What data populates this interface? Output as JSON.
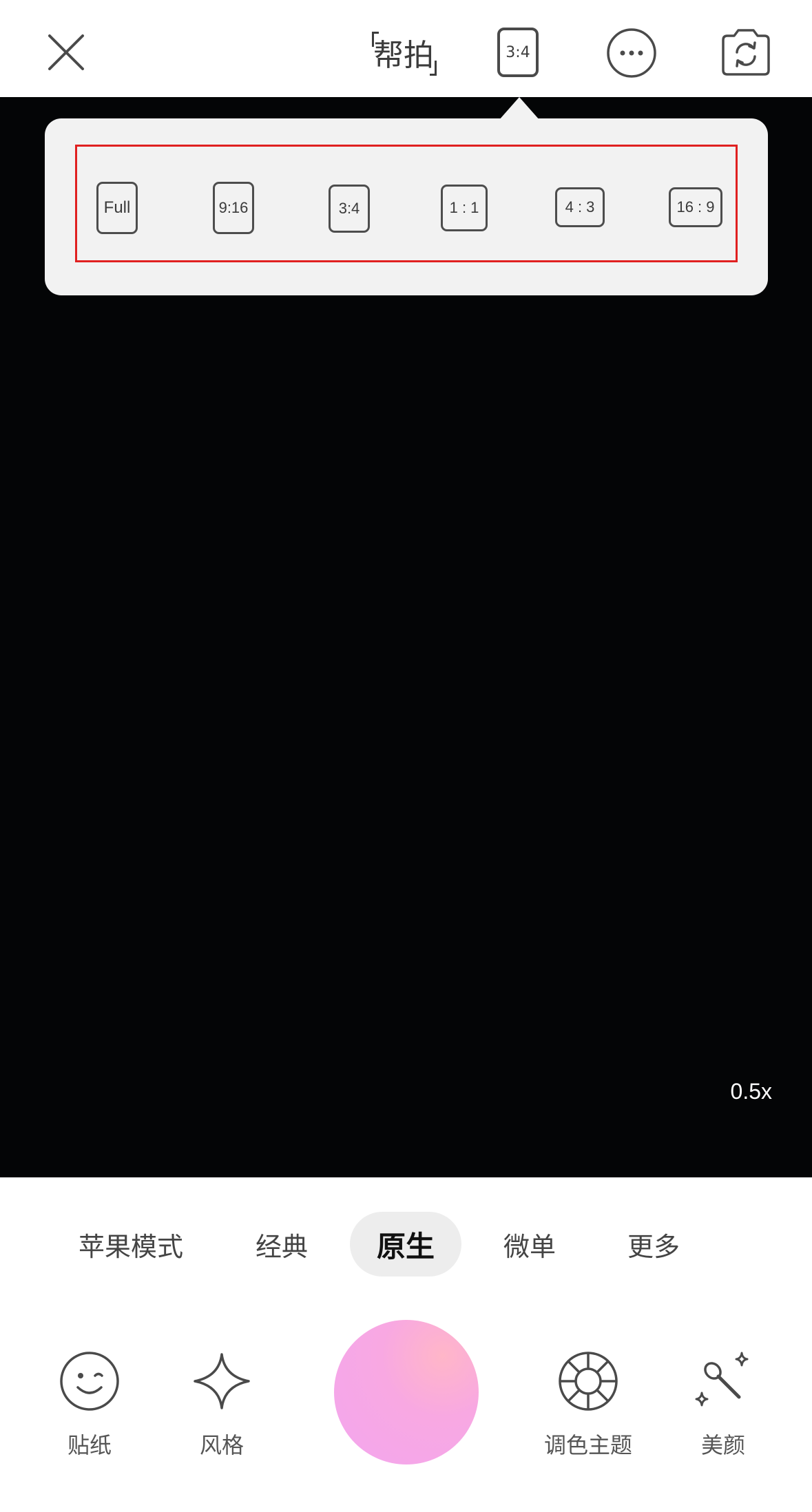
{
  "topbar": {
    "help_shoot_label": "帮拍",
    "current_ratio": "3:4"
  },
  "ratio_popup": {
    "options": [
      "Full",
      "9:16",
      "3:4",
      "1 : 1",
      "4 : 3",
      "16 : 9"
    ]
  },
  "viewfinder": {
    "zoom": "0.5x"
  },
  "modes": {
    "items": [
      "苹果模式",
      "经典",
      "原生",
      "微单",
      "更多"
    ],
    "selected": "原生"
  },
  "tools": {
    "sticker": "贴纸",
    "style": "风格",
    "color_theme": "调色主题",
    "beauty": "美颜"
  },
  "icons": {
    "close": "close-icon",
    "more": "more-icon",
    "flip": "camera-flip-icon",
    "sticker": "smiley-icon",
    "style": "sparkle-icon",
    "color_theme": "aperture-icon",
    "beauty": "magic-wand-icon"
  },
  "colors": {
    "viewfinder_bg": "#040506",
    "highlight_border": "#e02020",
    "popup_bg": "#f2f2f2",
    "shutter_gradient": [
      "#ffb6c8",
      "#f3a6ee"
    ]
  }
}
